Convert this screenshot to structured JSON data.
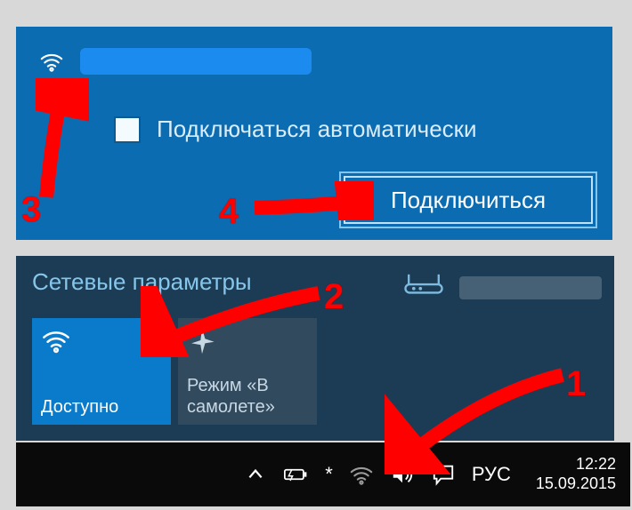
{
  "top_panel": {
    "connect_auto_label": "Подключаться автоматически",
    "connect_button": "Подключиться"
  },
  "settings": {
    "title": "Сетевые параметры",
    "wifi_tile_label": "Доступно",
    "airplane_tile_line1": "Режим «В",
    "airplane_tile_line2": "самолете»"
  },
  "taskbar": {
    "lang": "РУС",
    "time": "12:22",
    "date": "15.09.2015"
  },
  "annotations": {
    "n1": "1",
    "n2": "2",
    "n3": "3",
    "n4": "4"
  }
}
